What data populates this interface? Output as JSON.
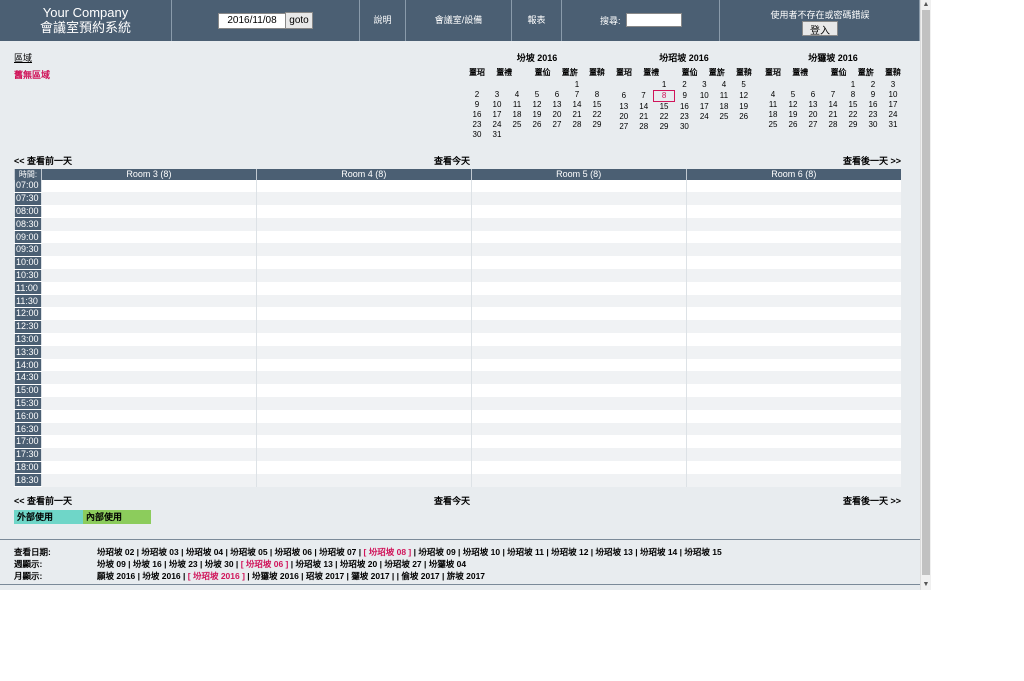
{
  "header": {
    "company": "Your Company",
    "system_name": "會議室預約系統",
    "date_value": "2016/11/08",
    "goto_label": "goto",
    "help_label": "說明",
    "rooms_label": "會議室/設備",
    "report_label": "報表",
    "search_label": "搜尋:",
    "login_message": "使用者不存在或密碼錯誤",
    "login_button": "登入"
  },
  "area": {
    "title": "區域",
    "empty_message": "舊無區域"
  },
  "calendars": [
    {
      "title": "坋坡 2016",
      "dow": [
        "罿玿",
        "罿禮",
        "",
        "罿佡",
        "罿旂",
        "罿鞥"
      ],
      "weeks": [
        [
          "",
          "",
          "",
          "",
          "",
          "1"
        ],
        [
          "2",
          "3",
          "4",
          "5",
          "6",
          "7",
          "8"
        ],
        [
          "9",
          "10",
          "11",
          "12",
          "13",
          "14",
          "15"
        ],
        [
          "16",
          "17",
          "18",
          "19",
          "20",
          "21",
          "22"
        ],
        [
          "23",
          "24",
          "25",
          "26",
          "27",
          "28",
          "29"
        ],
        [
          "30",
          "31",
          "",
          "",
          "",
          "",
          ""
        ]
      ]
    },
    {
      "title": "坋玿坡 2016",
      "dow": [
        "罿玿",
        "罿禮",
        "",
        "罿佡",
        "罿旂",
        "罿鞥"
      ],
      "weeks": [
        [
          "",
          "",
          "1",
          "2",
          "3",
          "4",
          "5"
        ],
        [
          "6",
          "7",
          "8",
          "9",
          "10",
          "11",
          "12"
        ],
        [
          "13",
          "14",
          "15",
          "16",
          "17",
          "18",
          "19"
        ],
        [
          "20",
          "21",
          "22",
          "23",
          "24",
          "25",
          "26"
        ],
        [
          "27",
          "28",
          "29",
          "30",
          "",
          "",
          ""
        ]
      ]
    },
    {
      "title": "坋玀坡 2016",
      "dow": [
        "罿玿",
        "罿禮",
        "",
        "罿佡",
        "罿旂",
        "罿鞥"
      ],
      "weeks": [
        [
          "",
          "",
          "",
          "",
          "1",
          "2",
          "3"
        ],
        [
          "4",
          "5",
          "6",
          "7",
          "8",
          "9",
          "10"
        ],
        [
          "11",
          "12",
          "13",
          "14",
          "15",
          "16",
          "17"
        ],
        [
          "18",
          "19",
          "20",
          "21",
          "22",
          "23",
          "24"
        ],
        [
          "25",
          "26",
          "27",
          "28",
          "29",
          "30",
          "31"
        ]
      ]
    }
  ],
  "today_cell": "8",
  "nav": {
    "prev": "<< 查看前一天",
    "today": "查看今天",
    "next": "查看後一天 >>"
  },
  "grid": {
    "time_header": "時間:",
    "rooms": [
      "Room 3 (8)",
      "Room 4 (8)",
      "Room 5 (8)",
      "Room 6 (8)"
    ],
    "times": [
      "07:00",
      "07:30",
      "08:00",
      "08:30",
      "09:00",
      "09:30",
      "10:00",
      "10:30",
      "11:00",
      "11:30",
      "12:00",
      "12:30",
      "13:00",
      "13:30",
      "14:00",
      "14:30",
      "15:00",
      "15:30",
      "16:00",
      "16:30",
      "17:00",
      "17:30",
      "18:00",
      "18:30"
    ]
  },
  "legend": {
    "external": "外部使用",
    "internal": "內部使用"
  },
  "footer": {
    "day_label": "查看日期:",
    "days_before": "坋玿坡 02 | 坋玿坡 03 | 坋玿坡 04 | 坋玿坡 05 | 坋玿坡 06 | 坋玿坡 07 |",
    "day_current": "[ 坋玿坡 08 ]",
    "days_after": "| 坋玿坡 09 | 坋玿坡 10 | 坋玿坡 11 | 坋玿坡 12 | 坋玿坡 13 | 坋玿坡 14 | 坋玿坡 15",
    "week_label": "週顯示:",
    "weeks_before": "坋坡 09 | 坋坡 16 | 坋坡 23 | 坋坡 30 |",
    "week_current": "[ 坋玿坡 06 ]",
    "weeks_after": "| 坋玿坡 13 | 坋玿坡 20 | 坋玿坡 27 | 坋玀坡 04",
    "month_label": "月顯示:",
    "months_before": "願坡 2016 | 坋坡 2016 |",
    "month_current": "[ 坋玿坡 2016 ]",
    "months_after": "| 坋玀坡 2016 | 玿坡 2017 | 玀坡 2017 | | 偷坡 2017 | 旂坡 2017"
  },
  "colors": {
    "header_bg": "#4b5f73",
    "page_bg": "#e8ecef",
    "highlight": "#d0145a",
    "external": "#6fd6c8",
    "internal": "#8ccc5c"
  }
}
